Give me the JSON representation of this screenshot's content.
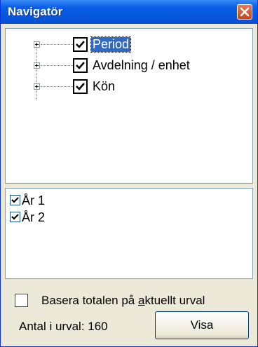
{
  "window": {
    "title": "Navigatör"
  },
  "tree": {
    "items": [
      {
        "label": "Period",
        "checked": true,
        "selected": true
      },
      {
        "label": "Avdelning / enhet",
        "checked": true,
        "selected": false
      },
      {
        "label": "Kön",
        "checked": true,
        "selected": false
      }
    ]
  },
  "list": {
    "items": [
      {
        "label": "År 1",
        "checked": true
      },
      {
        "label": "År 2",
        "checked": true
      }
    ]
  },
  "options": {
    "basera_prefix": "Basera totalen på ",
    "basera_underlined": "a",
    "basera_suffix": "ktuellt urval",
    "basera_checked": false
  },
  "footer": {
    "antal_label": "Antal i urval: 160",
    "visa_label": "Visa"
  },
  "colors": {
    "titlebar": "#0a5fe6",
    "selection": "#316ac5",
    "window_bg": "#ece9d8",
    "close_button": "#d4542c"
  }
}
